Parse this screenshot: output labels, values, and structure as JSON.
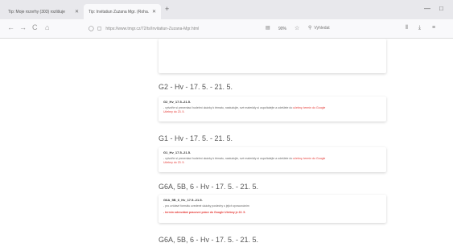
{
  "browser": {
    "tabs": [
      {
        "label": "Tip: Moje rozvrhy (303) rozlišuje"
      },
      {
        "label": "Tip: Invitatiun Zuzana Mgr. (Roha..."
      }
    ],
    "new_tab_symbol": "+",
    "window_controls": {
      "minimize": "—",
      "maximize": "□"
    },
    "nav": {
      "back": "←",
      "forward": "→",
      "reload": "C",
      "home": "⌂"
    },
    "url": "https://www.tmgr.cz/72/ts/Invitatiun-Zuzana-Mgr.html",
    "zoom": "90%",
    "search_placeholder": "Vyhledat"
  },
  "sections": [
    {
      "title": "G2 - Hv - 17. 5. - 21. 5.",
      "subject": "G2_Hv_17.5.-21.5.",
      "lines": [
        "- vytvořte si prezentaci hudební ukázky k tématu, nastudujte, své materiály si uspořádejte a odešlete do"
      ],
      "red_text": "učebny, termín do Google",
      "red_line": "Učebny do 23. 5."
    },
    {
      "title": "G1 - Hv - 17. 5. - 21. 5.",
      "subject": "G1_Hv_17.5.-21.5.",
      "lines": [
        "- vytvořte si prezentaci hudební ukázky k tématu, nastudujte, své materiály si uspořádejte a odešlete do"
      ],
      "red_text": "učebny, termín do Google",
      "red_line": "Učebny do 23. 5."
    },
    {
      "title": "G6A, 5B, 6 - Hv - 17. 5. - 21. 5.",
      "subject": "G6A_5B_6_Hv_17.5.-21.5.",
      "lines": [
        "- pro zvídavé formátu uvedené ukázky poslechy s jejich zpracováním"
      ],
      "red_bold": "- termín odevzdání pracovní práce do Google Učebny je 22. 5."
    },
    {
      "title": "G6A, 5B, 6 - Hv - 17. 5. - 21. 5."
    }
  ]
}
